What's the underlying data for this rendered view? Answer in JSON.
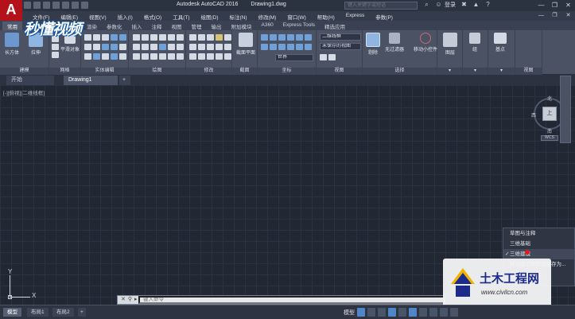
{
  "app": {
    "logo": "A",
    "title": "Autodesk AutoCAD 2016",
    "document": "Drawing1.dwg",
    "brand_watermark": "秒懂视频"
  },
  "search": {
    "placeholder": "键入关键字或短语"
  },
  "account": {
    "login": "登录"
  },
  "menus": [
    "文件(F)",
    "编辑(E)",
    "视图(V)",
    "插入(I)",
    "格式(O)",
    "工具(T)",
    "绘图(D)",
    "标注(N)",
    "修改(M)",
    "窗口(W)",
    "帮助(H)",
    "Express",
    "参数(P)"
  ],
  "ribbon_tabs": [
    {
      "label": "常用",
      "active": true
    },
    {
      "label": "实体"
    },
    {
      "label": "曲面"
    },
    {
      "label": "网格"
    },
    {
      "label": "渲染"
    },
    {
      "label": "参数化"
    },
    {
      "label": "插入"
    },
    {
      "label": "注释"
    },
    {
      "label": "视图"
    },
    {
      "label": "管理"
    },
    {
      "label": "输出"
    },
    {
      "label": "附加模块"
    },
    {
      "label": "A360"
    },
    {
      "label": "Express Tools"
    },
    {
      "label": "精选应用"
    }
  ],
  "ribbon": {
    "modeling": {
      "box": "长方体",
      "extrude": "拉伸",
      "label": "建模"
    },
    "mesh": {
      "smooth": "平滑对象",
      "label": "网格"
    },
    "solid_edit": {
      "label": "实体编辑"
    },
    "draw": {
      "label": "绘图"
    },
    "modify": {
      "label": "修改"
    },
    "section": {
      "plane": "截面平面",
      "label": "截面"
    },
    "coordinates": {
      "world": "世界",
      "label": "坐标"
    },
    "view": {
      "visual_style": "二维线框",
      "saved_view": "未保存的视图",
      "label": "视图"
    },
    "selection": {
      "culling": "剔除",
      "no_filter": "无过滤器",
      "move_gizmo": "移动小控件",
      "label": "选择"
    },
    "layers": {
      "label": "图层"
    },
    "groups": {
      "label": "组"
    },
    "base": {
      "label": "基点"
    },
    "view2": {
      "label": "视图"
    }
  },
  "doc_tabs": [
    {
      "label": "开始"
    },
    {
      "label": "Drawing1",
      "active": true
    },
    {
      "label": "+"
    }
  ],
  "viewport": {
    "label": "[-][俯视][二维线框]"
  },
  "viewcube": {
    "north": "北",
    "south": "南",
    "east": "东",
    "west": "西",
    "face": "上",
    "wcs": "WCS"
  },
  "ucs": {
    "y": "Y",
    "x": "X"
  },
  "context_menu": {
    "items": [
      {
        "label": "草图与注释",
        "checked": false
      },
      {
        "label": "三维基础",
        "checked": false
      },
      {
        "label": "三维建模",
        "checked": true
      },
      {
        "label": "将当前工作空间另存为...",
        "checked": false
      },
      {
        "label": "工作空间设置...",
        "checked": false
      }
    ]
  },
  "command": {
    "placeholder": "键入命令"
  },
  "status_tabs": [
    {
      "label": "模型",
      "active": true
    },
    {
      "label": "布局1"
    },
    {
      "label": "布局2"
    },
    {
      "label": "+"
    }
  ],
  "status": {
    "model": "模型"
  },
  "site_watermark": {
    "name": "土木工程网",
    "url": "www.civilcn.com"
  }
}
